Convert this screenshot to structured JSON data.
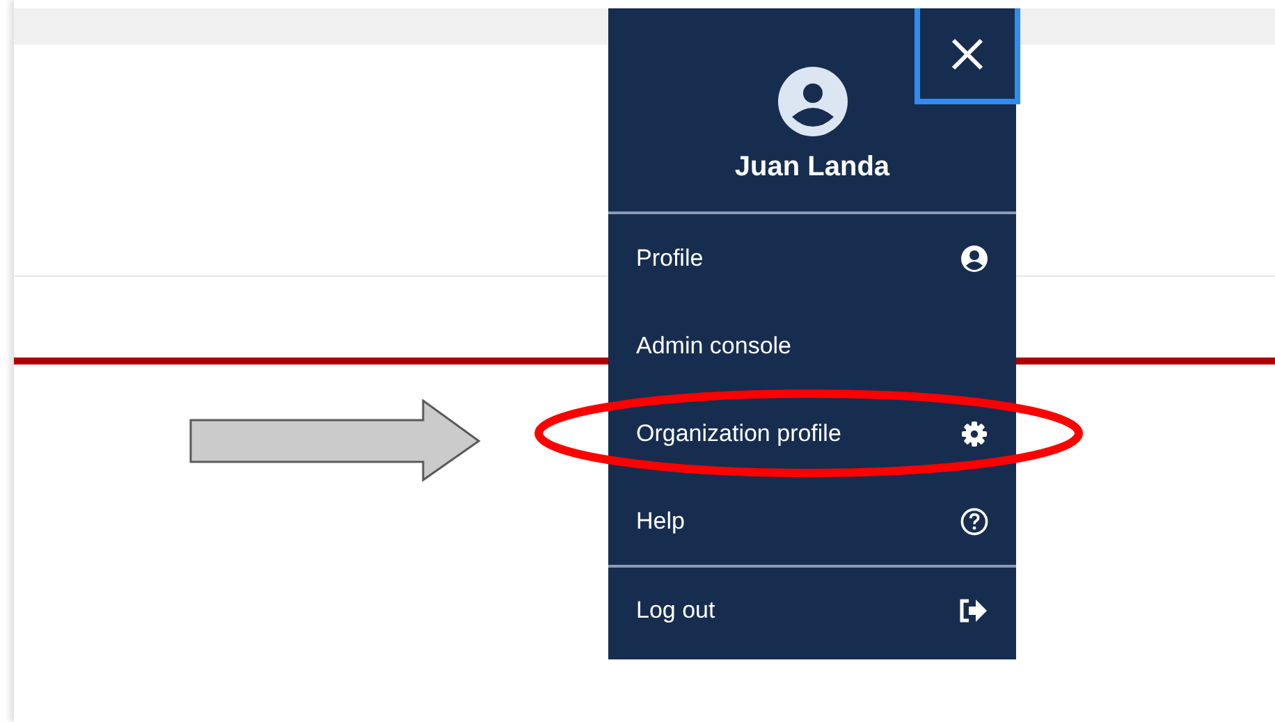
{
  "user_menu": {
    "user_name": "Juan Landa",
    "close_button": {
      "focused": true
    },
    "items": [
      {
        "label": "Profile",
        "separated": false,
        "highlighted": false
      },
      {
        "label": "Admin console",
        "separated": false,
        "highlighted": false
      },
      {
        "label": "Organization profile",
        "separated": false,
        "highlighted": true
      },
      {
        "label": "Help",
        "separated": false,
        "highlighted": false
      },
      {
        "label": "Log out",
        "separated": true,
        "highlighted": false
      }
    ]
  },
  "annotations": [
    {
      "kind": "arrow"
    }
  ]
}
